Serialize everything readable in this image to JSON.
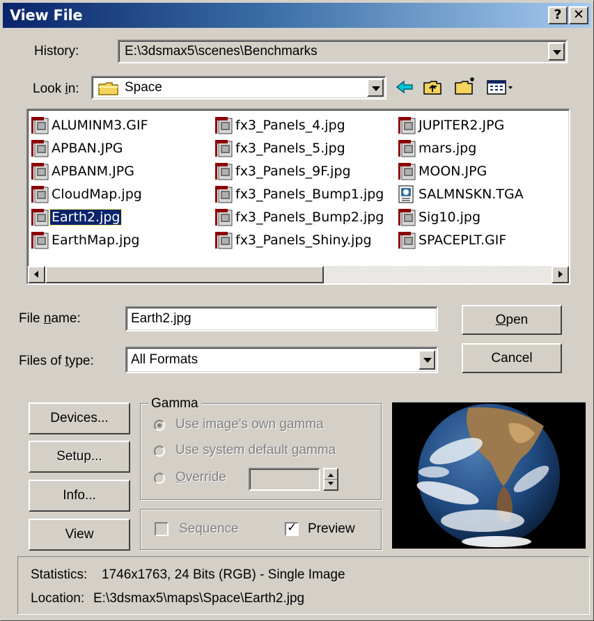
{
  "window": {
    "title": "View File"
  },
  "titlebar": {
    "help": "?",
    "close": "✕"
  },
  "history": {
    "label": "History:",
    "value": "E:\\3dsmax5\\scenes\\Benchmarks"
  },
  "lookin": {
    "label_pre": "Look ",
    "label_u": "i",
    "label_post": "n:",
    "value": "Space"
  },
  "files": {
    "col1": [
      "ALUMINM3.GIF",
      "APBAN.JPG",
      "APBANM.JPG",
      "CloudMap.jpg",
      "Earth2.jpg",
      "EarthMap.jpg"
    ],
    "col2": [
      "fx3_Panels_4.jpg",
      "fx3_Panels_5.jpg",
      "fx3_Panels_9F.jpg",
      "fx3_Panels_Bump1.jpg",
      "fx3_Panels_Bump2.jpg",
      "fx3_Panels_Shiny.jpg"
    ],
    "col3": [
      "JUPITER2.JPG",
      "mars.jpg",
      "MOON.JPG",
      "SALMNSKN.TGA",
      "Sig10.jpg",
      "SPACEPLT.GIF"
    ],
    "selected": "Earth2.jpg"
  },
  "filename": {
    "label_pre": "File ",
    "label_u": "n",
    "label_post": "ame:",
    "value": "Earth2.jpg"
  },
  "filetype": {
    "label_pre": "Files of ",
    "label_u": "t",
    "label_post": "ype:",
    "value": "All Formats"
  },
  "buttons": {
    "open_u": "O",
    "open_rest": "pen",
    "cancel": "Cancel",
    "devices": "Devices...",
    "setup": "Setup...",
    "info": "Info...",
    "view": "View"
  },
  "gamma": {
    "title": "Gamma",
    "own": "Use image's own gamma",
    "system": "Use system default gamma",
    "override_u": "O",
    "override_rest": "verride",
    "own_selected": true
  },
  "options": {
    "sequence": "Sequence",
    "preview": "Preview",
    "sequence_checked": false,
    "preview_checked": true
  },
  "status": {
    "stats_label": "Statistics:",
    "stats_value": "1746x1763, 24 Bits (RGB) - Single Image",
    "loc_label": "Location:",
    "loc_value": "E:\\3dsmax5\\maps\\Space\\Earth2.jpg"
  },
  "colors": {
    "title_start": "#0a246a",
    "title_end": "#a6caf0",
    "face": "#d4d0c8",
    "selection": "#0a246a"
  }
}
